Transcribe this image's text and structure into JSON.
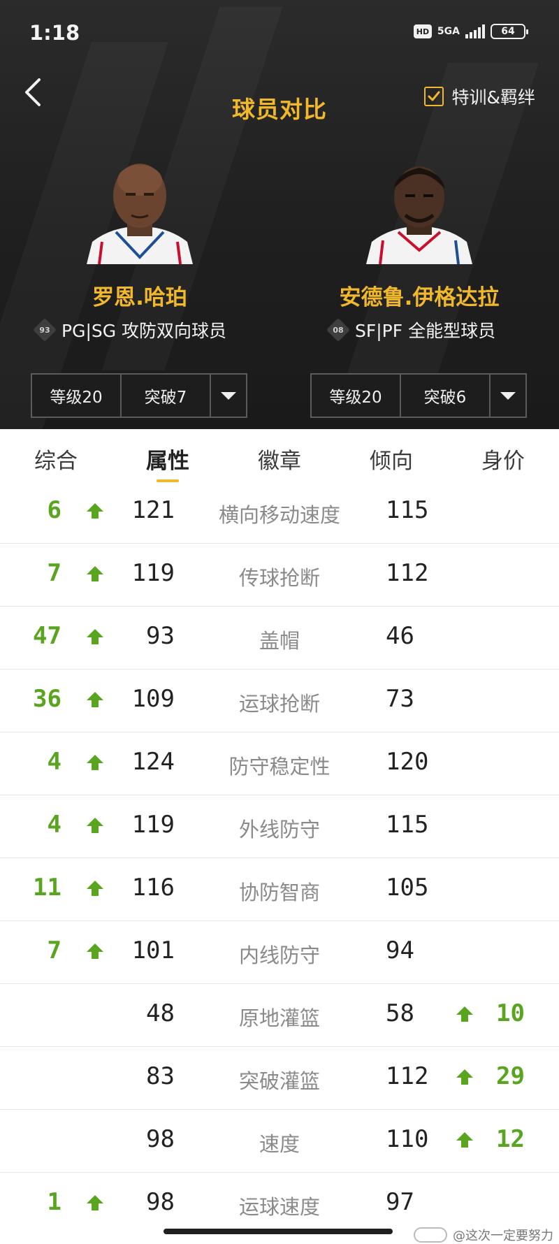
{
  "status_bar": {
    "time": "1:18",
    "hd": "HD",
    "network": "5GA",
    "battery": "64"
  },
  "header": {
    "title": "球员对比",
    "train_toggle_label": "特训&羁绊",
    "train_toggle_checked": true
  },
  "players": [
    {
      "name": "罗恩.哈珀",
      "jersey_number": "93",
      "desc": "PG|SG 攻防双向球员",
      "grade_label": "等级20",
      "breakthrough_label": "突破7"
    },
    {
      "name": "安德鲁.伊格达拉",
      "jersey_number": "08",
      "desc": "SF|PF 全能型球员",
      "grade_label": "等级20",
      "breakthrough_label": "突破6"
    }
  ],
  "tabs": [
    {
      "label": "综合",
      "active": false
    },
    {
      "label": "属性",
      "active": true
    },
    {
      "label": "徽章",
      "active": false
    },
    {
      "label": "倾向",
      "active": false
    },
    {
      "label": "身价",
      "active": false
    }
  ],
  "rows": [
    {
      "name": "横向移动速度",
      "left": "121",
      "right": "115",
      "diff_left": "6",
      "diff_right": ""
    },
    {
      "name": "传球抢断",
      "left": "119",
      "right": "112",
      "diff_left": "7",
      "diff_right": ""
    },
    {
      "name": "盖帽",
      "left": "93",
      "right": "46",
      "diff_left": "47",
      "diff_right": ""
    },
    {
      "name": "运球抢断",
      "left": "109",
      "right": "73",
      "diff_left": "36",
      "diff_right": ""
    },
    {
      "name": "防守稳定性",
      "left": "124",
      "right": "120",
      "diff_left": "4",
      "diff_right": ""
    },
    {
      "name": "外线防守",
      "left": "119",
      "right": "115",
      "diff_left": "4",
      "diff_right": ""
    },
    {
      "name": "协防智商",
      "left": "116",
      "right": "105",
      "diff_left": "11",
      "diff_right": ""
    },
    {
      "name": "内线防守",
      "left": "101",
      "right": "94",
      "diff_left": "7",
      "diff_right": ""
    },
    {
      "name": "原地灌篮",
      "left": "48",
      "right": "58",
      "diff_left": "",
      "diff_right": "10"
    },
    {
      "name": "突破灌篮",
      "left": "83",
      "right": "112",
      "diff_left": "",
      "diff_right": "29"
    },
    {
      "name": "速度",
      "left": "98",
      "right": "110",
      "diff_left": "",
      "diff_right": "12"
    },
    {
      "name": "运球速度",
      "left": "98",
      "right": "97",
      "diff_left": "1",
      "diff_right": ""
    }
  ],
  "watermark": "@这次一定要努力",
  "colors": {
    "accent": "#f1b82b",
    "up_green": "#5aa51f",
    "header_bg": "#1f1f1f"
  },
  "icons": {
    "back": "chevron-left-icon",
    "check": "checkmark-icon",
    "dropdown": "triangle-down-icon",
    "increase": "arrow-up-icon"
  }
}
